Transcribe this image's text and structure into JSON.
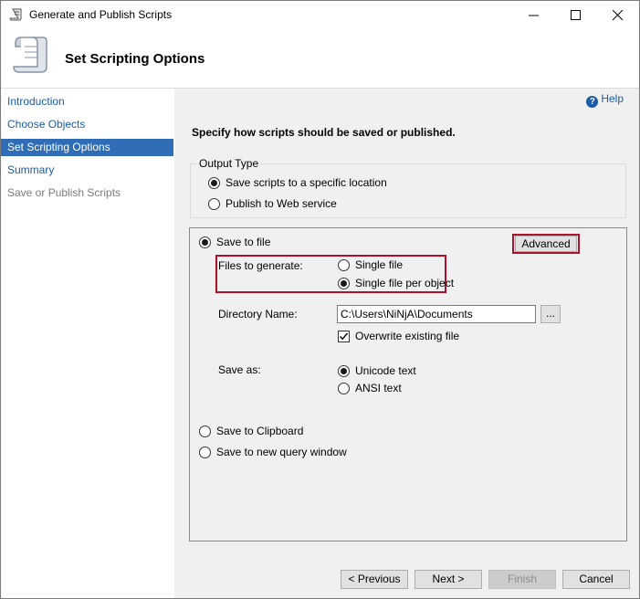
{
  "window": {
    "title": "Generate and Publish Scripts",
    "app_icon": "scroll-icon",
    "controls": [
      "minimize-icon",
      "maximize-icon",
      "close-icon"
    ]
  },
  "header": {
    "title": "Set Scripting Options",
    "icon": "scroll-icon"
  },
  "sidebar": {
    "items": [
      {
        "label": "Introduction",
        "state": "link"
      },
      {
        "label": "Choose Objects",
        "state": "link"
      },
      {
        "label": "Set Scripting Options",
        "state": "selected"
      },
      {
        "label": "Summary",
        "state": "link"
      },
      {
        "label": "Save or Publish Scripts",
        "state": "disabled"
      }
    ]
  },
  "content": {
    "help": "Help",
    "instruction": "Specify how scripts should be saved or published.",
    "output_type": {
      "legend": "Output Type",
      "options": [
        {
          "label": "Save scripts to a specific location",
          "selected": true
        },
        {
          "label": "Publish to Web service",
          "selected": false
        }
      ]
    },
    "save_panel": {
      "save_to_file": "Save to file",
      "advanced": "Advanced",
      "files_to_generate": {
        "label": "Files to generate:",
        "options": [
          {
            "label": "Single file",
            "selected": false
          },
          {
            "label": "Single file per object",
            "selected": true
          }
        ]
      },
      "directory": {
        "label": "Directory Name:",
        "value": "C:\\Users\\NiNjA\\Documents",
        "browse": "..."
      },
      "overwrite": {
        "label": "Overwrite existing file",
        "checked": true
      },
      "save_as": {
        "label": "Save as:",
        "options": [
          {
            "label": "Unicode text",
            "selected": true
          },
          {
            "label": "ANSI text",
            "selected": false
          }
        ]
      },
      "clipboard": "Save to Clipboard",
      "query_window": "Save to new query window"
    }
  },
  "footer": {
    "previous": "< Previous",
    "next": "Next >",
    "finish": "Finish",
    "cancel": "Cancel"
  },
  "colors": {
    "selection": "#2f6db6",
    "link": "#1a5ca8",
    "highlight_box": "#b0102a",
    "dialog_bg": "#f0f0f0"
  }
}
